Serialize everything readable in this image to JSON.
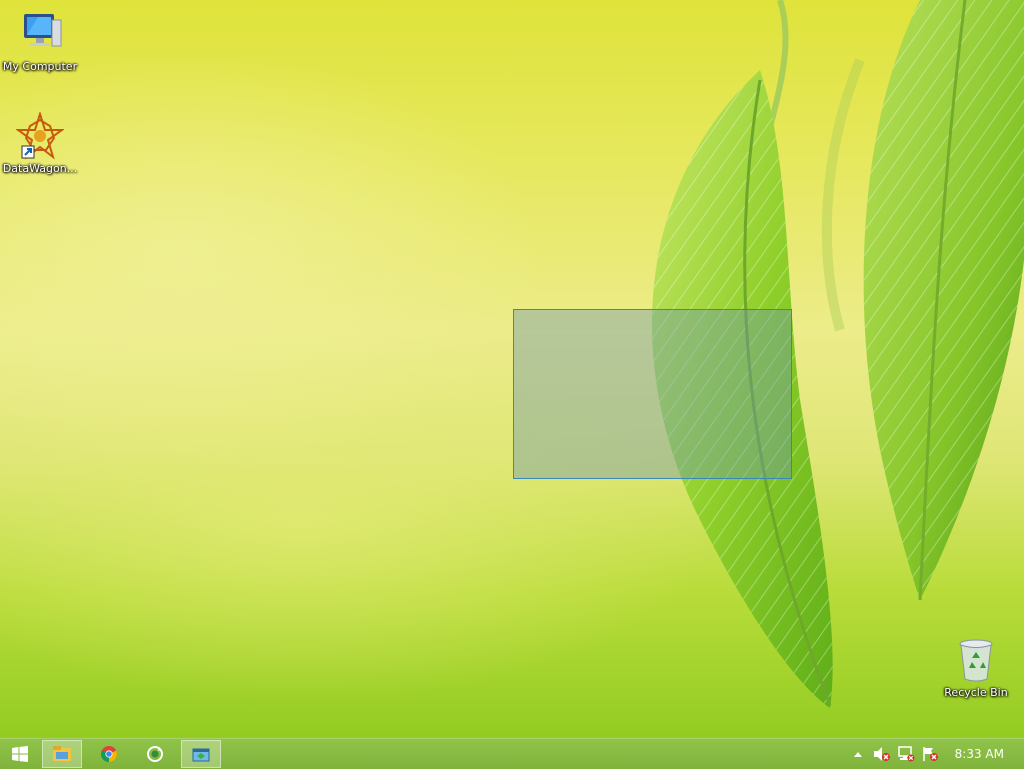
{
  "desktop": {
    "icons": [
      {
        "label": "My Computer",
        "icon": "my-computer-icon"
      },
      {
        "label": "DataWagon...",
        "icon": "datawagon-icon"
      },
      {
        "label": "Recycle Bin",
        "icon": "recycle-bin-icon"
      }
    ]
  },
  "taskbar": {
    "start": {
      "icon": "windows-start-icon"
    },
    "pinned": [
      {
        "icon": "file-explorer-icon",
        "active": true
      },
      {
        "icon": "chrome-icon",
        "active": false
      },
      {
        "icon": "refresh-app-icon",
        "active": false
      },
      {
        "icon": "app-window-icon",
        "active": true
      }
    ],
    "tray": {
      "items": [
        "show-hidden-icons-arrow",
        "volume-muted-icon",
        "network-disconnected-icon",
        "action-center-flag-icon"
      ],
      "time": "8:33 AM"
    }
  },
  "colors": {
    "taskbar": "#84b842",
    "selection_fill": "#6e96af",
    "selection_border": "#3282be"
  }
}
